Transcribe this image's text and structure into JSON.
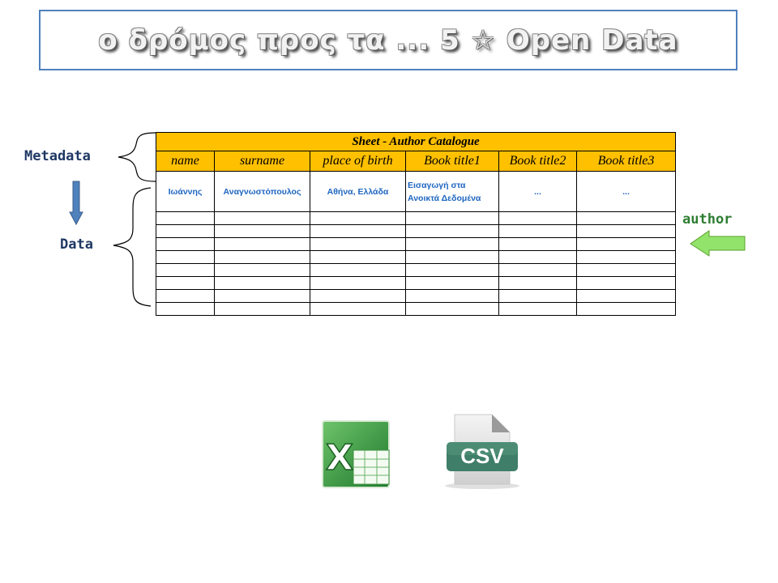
{
  "title": "ο δρόμος προς τα ... 5 ☆ Open Data",
  "labels": {
    "metadata": "Metadata",
    "data": "Data",
    "author": "author"
  },
  "sheet": {
    "title": "Sheet - Author Catalogue",
    "headers": [
      "name",
      "surname",
      "place of birth",
      "Book title1",
      "Book title2",
      "Book title3"
    ],
    "row1": [
      "Ιωάννης",
      "Αναγνωστόπουλος",
      "Αθήνα, Ελλάδα",
      "Εισαγωγή στα Ανοικτά Δεδομένα",
      "...",
      "..."
    ],
    "empty_rows": 8
  },
  "icons": {
    "excel": "excel-icon",
    "csv_label": "CSV"
  },
  "colors": {
    "header_fill": "#ffc000",
    "data_text": "#1f66c1",
    "metadata_label": "#1f3864",
    "author_label": "#2e7d32",
    "arrow_blue": "#4f81bd",
    "arrow_green": "#92e36b"
  }
}
